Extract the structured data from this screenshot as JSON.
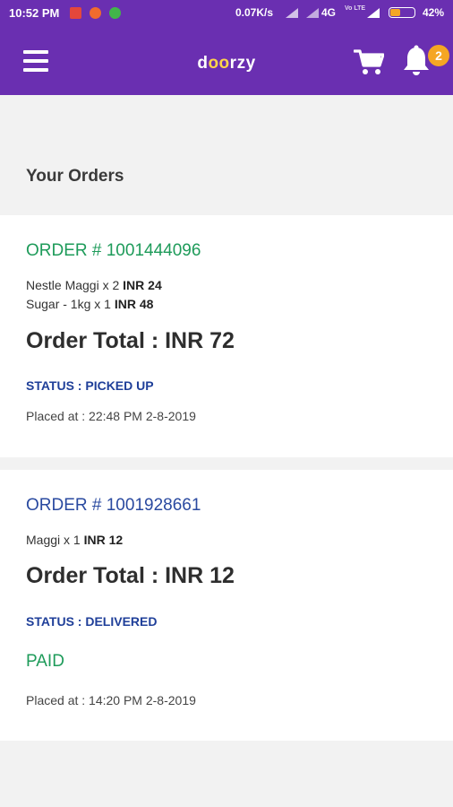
{
  "status_bar": {
    "time": "10:52 PM",
    "speed": "0.07K/s",
    "network": "4G",
    "volte": "Vo LTE",
    "battery_percent": "42%",
    "battery_level": 0.42
  },
  "app_bar": {
    "logo_prefix": "d",
    "logo_oo": "oo",
    "logo_suffix": "rzy",
    "notification_count": "2"
  },
  "page": {
    "title": "Your Orders"
  },
  "orders": [
    {
      "order_label": "ORDER # 1001444096",
      "items": [
        {
          "name": "Nestle Maggi x 2",
          "price": "INR 24"
        },
        {
          "name": " Sugar - 1kg x 1",
          "price": "INR 48"
        }
      ],
      "total": "Order Total : INR 72",
      "status": "STATUS : PICKED UP",
      "placed": "Placed at : 22:48 PM  2-8-2019"
    },
    {
      "order_label": "ORDER # 1001928661",
      "items": [
        {
          "name": " Maggi x 1",
          "price": "INR 12"
        }
      ],
      "total": "Order Total : INR 12",
      "status": "STATUS : DELIVERED",
      "payment": "PAID",
      "placed": "Placed at : 14:20 PM  2-8-2019"
    }
  ],
  "colors": {
    "brand": "#6a2fb1",
    "accent": "#f5a623",
    "order_green": "#1e9b5a",
    "status_blue": "#1f3f99"
  },
  "icons": [
    "menu-icon",
    "cart-icon",
    "bell-icon"
  ]
}
